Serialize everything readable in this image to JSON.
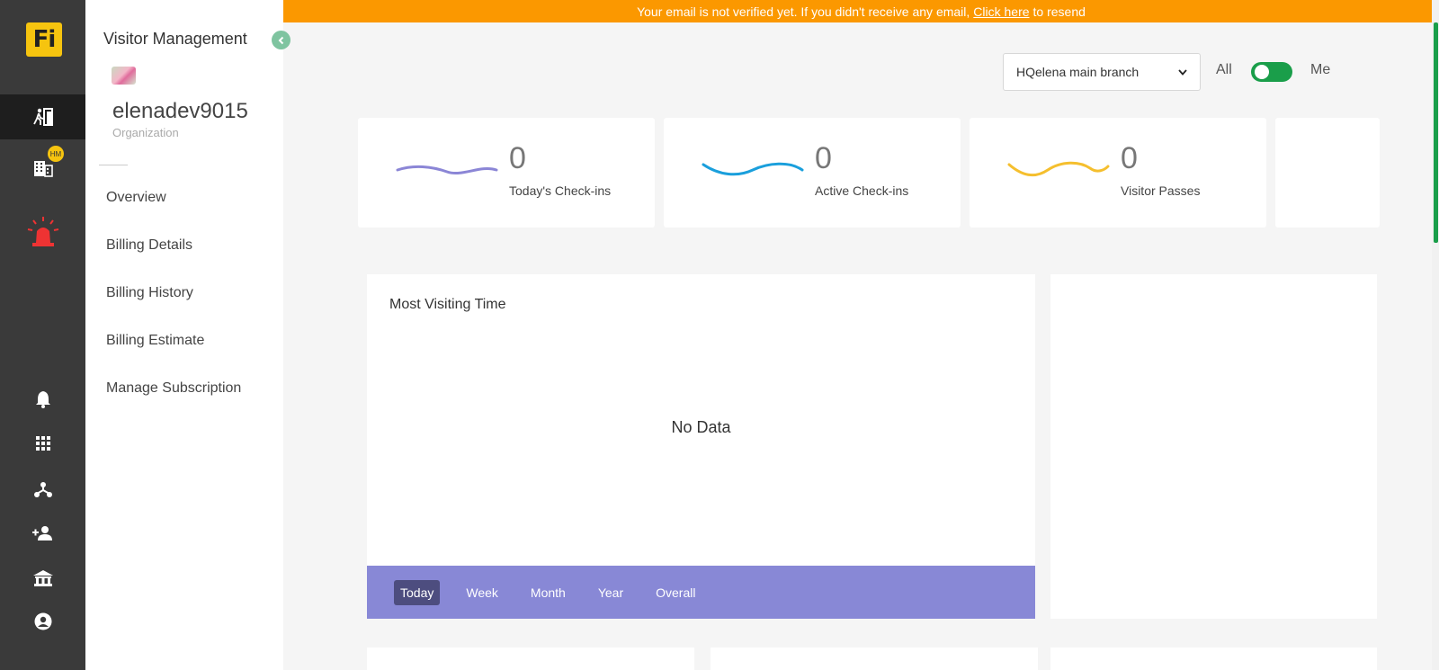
{
  "banner": {
    "text_before": "Your email is not verified yet. If you didn't receive any email,",
    "link": "Click here",
    "text_after": "to resend"
  },
  "rail": {
    "logo": "Fi",
    "badge": "HM",
    "icons": [
      "visitor-checkin-icon",
      "building-icon",
      "siren-icon",
      "bell-icon",
      "apps-grid-icon",
      "hierarchy-icon",
      "add-user-icon",
      "institution-icon",
      "account-icon"
    ]
  },
  "sidebar": {
    "title": "Visitor Management",
    "org_name": "elenadev9015",
    "org_sub": "Organization",
    "links": [
      "Overview",
      "Billing Details",
      "Billing History",
      "Billing Estimate",
      "Manage Subscription"
    ]
  },
  "filters": {
    "branch": "HQelena main branch",
    "all_label": "All",
    "me_label": "Me",
    "toggle_on": true
  },
  "stats": [
    {
      "value": "0",
      "label": "Today's Check-ins",
      "color": "#8b86d6"
    },
    {
      "value": "0",
      "label": "Active Check-ins",
      "color": "#1a9fdc"
    },
    {
      "value": "0",
      "label": "Visitor Passes",
      "color": "#f5bf2e"
    }
  ],
  "chart_panel": {
    "title": "Most Visiting Time",
    "empty_text": "No Data",
    "periods": [
      "Today",
      "Week",
      "Month",
      "Year",
      "Overall"
    ],
    "active_period": "Today"
  },
  "colors": {
    "banner": "#fb9800",
    "accent_green": "#1a9e4a",
    "period_bar": "#8888d6",
    "logo": "#f6c40f"
  }
}
